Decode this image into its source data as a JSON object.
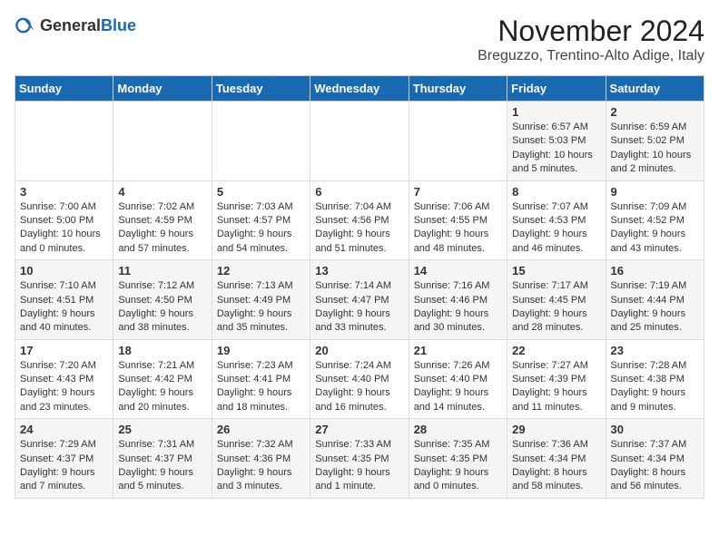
{
  "header": {
    "logo_general": "General",
    "logo_blue": "Blue",
    "month_title": "November 2024",
    "location": "Breguzzo, Trentino-Alto Adige, Italy"
  },
  "days_of_week": [
    "Sunday",
    "Monday",
    "Tuesday",
    "Wednesday",
    "Thursday",
    "Friday",
    "Saturday"
  ],
  "weeks": [
    [
      {
        "day": "",
        "info": ""
      },
      {
        "day": "",
        "info": ""
      },
      {
        "day": "",
        "info": ""
      },
      {
        "day": "",
        "info": ""
      },
      {
        "day": "",
        "info": ""
      },
      {
        "day": "1",
        "info": "Sunrise: 6:57 AM\nSunset: 5:03 PM\nDaylight: 10 hours and 5 minutes."
      },
      {
        "day": "2",
        "info": "Sunrise: 6:59 AM\nSunset: 5:02 PM\nDaylight: 10 hours and 2 minutes."
      }
    ],
    [
      {
        "day": "3",
        "info": "Sunrise: 7:00 AM\nSunset: 5:00 PM\nDaylight: 10 hours and 0 minutes."
      },
      {
        "day": "4",
        "info": "Sunrise: 7:02 AM\nSunset: 4:59 PM\nDaylight: 9 hours and 57 minutes."
      },
      {
        "day": "5",
        "info": "Sunrise: 7:03 AM\nSunset: 4:57 PM\nDaylight: 9 hours and 54 minutes."
      },
      {
        "day": "6",
        "info": "Sunrise: 7:04 AM\nSunset: 4:56 PM\nDaylight: 9 hours and 51 minutes."
      },
      {
        "day": "7",
        "info": "Sunrise: 7:06 AM\nSunset: 4:55 PM\nDaylight: 9 hours and 48 minutes."
      },
      {
        "day": "8",
        "info": "Sunrise: 7:07 AM\nSunset: 4:53 PM\nDaylight: 9 hours and 46 minutes."
      },
      {
        "day": "9",
        "info": "Sunrise: 7:09 AM\nSunset: 4:52 PM\nDaylight: 9 hours and 43 minutes."
      }
    ],
    [
      {
        "day": "10",
        "info": "Sunrise: 7:10 AM\nSunset: 4:51 PM\nDaylight: 9 hours and 40 minutes."
      },
      {
        "day": "11",
        "info": "Sunrise: 7:12 AM\nSunset: 4:50 PM\nDaylight: 9 hours and 38 minutes."
      },
      {
        "day": "12",
        "info": "Sunrise: 7:13 AM\nSunset: 4:49 PM\nDaylight: 9 hours and 35 minutes."
      },
      {
        "day": "13",
        "info": "Sunrise: 7:14 AM\nSunset: 4:47 PM\nDaylight: 9 hours and 33 minutes."
      },
      {
        "day": "14",
        "info": "Sunrise: 7:16 AM\nSunset: 4:46 PM\nDaylight: 9 hours and 30 minutes."
      },
      {
        "day": "15",
        "info": "Sunrise: 7:17 AM\nSunset: 4:45 PM\nDaylight: 9 hours and 28 minutes."
      },
      {
        "day": "16",
        "info": "Sunrise: 7:19 AM\nSunset: 4:44 PM\nDaylight: 9 hours and 25 minutes."
      }
    ],
    [
      {
        "day": "17",
        "info": "Sunrise: 7:20 AM\nSunset: 4:43 PM\nDaylight: 9 hours and 23 minutes."
      },
      {
        "day": "18",
        "info": "Sunrise: 7:21 AM\nSunset: 4:42 PM\nDaylight: 9 hours and 20 minutes."
      },
      {
        "day": "19",
        "info": "Sunrise: 7:23 AM\nSunset: 4:41 PM\nDaylight: 9 hours and 18 minutes."
      },
      {
        "day": "20",
        "info": "Sunrise: 7:24 AM\nSunset: 4:40 PM\nDaylight: 9 hours and 16 minutes."
      },
      {
        "day": "21",
        "info": "Sunrise: 7:26 AM\nSunset: 4:40 PM\nDaylight: 9 hours and 14 minutes."
      },
      {
        "day": "22",
        "info": "Sunrise: 7:27 AM\nSunset: 4:39 PM\nDaylight: 9 hours and 11 minutes."
      },
      {
        "day": "23",
        "info": "Sunrise: 7:28 AM\nSunset: 4:38 PM\nDaylight: 9 hours and 9 minutes."
      }
    ],
    [
      {
        "day": "24",
        "info": "Sunrise: 7:29 AM\nSunset: 4:37 PM\nDaylight: 9 hours and 7 minutes."
      },
      {
        "day": "25",
        "info": "Sunrise: 7:31 AM\nSunset: 4:37 PM\nDaylight: 9 hours and 5 minutes."
      },
      {
        "day": "26",
        "info": "Sunrise: 7:32 AM\nSunset: 4:36 PM\nDaylight: 9 hours and 3 minutes."
      },
      {
        "day": "27",
        "info": "Sunrise: 7:33 AM\nSunset: 4:35 PM\nDaylight: 9 hours and 1 minute."
      },
      {
        "day": "28",
        "info": "Sunrise: 7:35 AM\nSunset: 4:35 PM\nDaylight: 9 hours and 0 minutes."
      },
      {
        "day": "29",
        "info": "Sunrise: 7:36 AM\nSunset: 4:34 PM\nDaylight: 8 hours and 58 minutes."
      },
      {
        "day": "30",
        "info": "Sunrise: 7:37 AM\nSunset: 4:34 PM\nDaylight: 8 hours and 56 minutes."
      }
    ]
  ]
}
